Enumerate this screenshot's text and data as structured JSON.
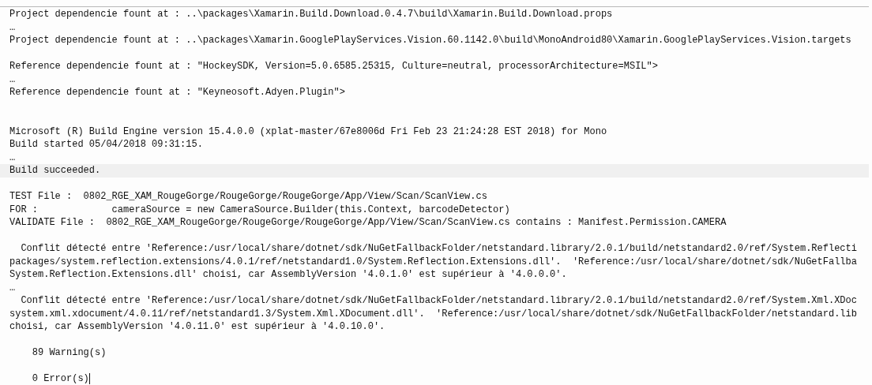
{
  "editor": {
    "lines": [
      {
        "kind": "text",
        "text": "Project dependencie fount at : ..\\packages\\Xamarin.Build.Download.0.4.7\\build\\Xamarin.Build.Download.props",
        "highlighted": false,
        "caret": false
      },
      {
        "kind": "text",
        "text": "…",
        "highlighted": false,
        "caret": false
      },
      {
        "kind": "text",
        "text": "Project dependencie fount at : ..\\packages\\Xamarin.GooglePlayServices.Vision.60.1142.0\\build\\MonoAndroid80\\Xamarin.GooglePlayServices.Vision.targets",
        "highlighted": false,
        "caret": false
      },
      {
        "kind": "blank"
      },
      {
        "kind": "text",
        "text": "Reference dependencie fount at : \"HockeySDK, Version=5.0.6585.25315, Culture=neutral, processorArchitecture=MSIL\">",
        "highlighted": false,
        "caret": false
      },
      {
        "kind": "text",
        "text": "…",
        "highlighted": false,
        "caret": false
      },
      {
        "kind": "text",
        "text": "Reference dependencie fount at : \"Keyneosoft.Adyen.Plugin\">",
        "highlighted": false,
        "caret": false
      },
      {
        "kind": "blank"
      },
      {
        "kind": "blank"
      },
      {
        "kind": "text",
        "text": "Microsoft (R) Build Engine version 15.4.0.0 (xplat-master/67e8006d Fri Feb 23 21:24:28 EST 2018) for Mono",
        "highlighted": false,
        "caret": false
      },
      {
        "kind": "text",
        "text": "Build started 05/04/2018 09:31:15.",
        "highlighted": false,
        "caret": false
      },
      {
        "kind": "text",
        "text": "…",
        "highlighted": false,
        "caret": false
      },
      {
        "kind": "text",
        "text": "Build succeeded.",
        "highlighted": true,
        "caret": false
      },
      {
        "kind": "blank"
      },
      {
        "kind": "text",
        "text": "TEST File :  0802_RGE_XAM_RougeGorge/RougeGorge/RougeGorge/App/View/Scan/ScanView.cs",
        "highlighted": false,
        "caret": false
      },
      {
        "kind": "text",
        "text": "FOR :             cameraSource = new CameraSource.Builder(this.Context, barcodeDetector)",
        "highlighted": false,
        "caret": false
      },
      {
        "kind": "text",
        "text": "VALIDATE File :  0802_RGE_XAM_RougeGorge/RougeGorge/RougeGorge/App/View/Scan/ScanView.cs contains : Manifest.Permission.CAMERA",
        "highlighted": false,
        "caret": false
      },
      {
        "kind": "blank"
      },
      {
        "kind": "text",
        "text": "  Conflit détecté entre 'Reference:/usr/local/share/dotnet/sdk/NuGetFallbackFolder/netstandard.library/2.0.1/build/netstandard2.0/ref/System.Reflecti",
        "highlighted": false,
        "caret": false
      },
      {
        "kind": "text",
        "text": "packages/system.reflection.extensions/4.0.1/ref/netstandard1.0/System.Reflection.Extensions.dll'.  'Reference:/usr/local/share/dotnet/sdk/NuGetFallba",
        "highlighted": false,
        "caret": false
      },
      {
        "kind": "text",
        "text": "System.Reflection.Extensions.dll' choisi, car AssemblyVersion '4.0.1.0' est supérieur à '4.0.0.0'.",
        "highlighted": false,
        "caret": false
      },
      {
        "kind": "text",
        "text": "…",
        "highlighted": false,
        "caret": false
      },
      {
        "kind": "text",
        "text": "  Conflit détecté entre 'Reference:/usr/local/share/dotnet/sdk/NuGetFallbackFolder/netstandard.library/2.0.1/build/netstandard2.0/ref/System.Xml.XDoc",
        "highlighted": false,
        "caret": false
      },
      {
        "kind": "text",
        "text": "system.xml.xdocument/4.0.11/ref/netstandard1.3/System.Xml.XDocument.dll'.  'Reference:/usr/local/share/dotnet/sdk/NuGetFallbackFolder/netstandard.lib",
        "highlighted": false,
        "caret": false
      },
      {
        "kind": "text",
        "text": "choisi, car AssemblyVersion '4.0.11.0' est supérieur à '4.0.10.0'.",
        "highlighted": false,
        "caret": false
      },
      {
        "kind": "blank"
      },
      {
        "kind": "text",
        "text": "    89 Warning(s)",
        "highlighted": false,
        "caret": false
      },
      {
        "kind": "blank"
      },
      {
        "kind": "text",
        "text": "    0 Error(s)",
        "highlighted": false,
        "caret": true
      }
    ]
  }
}
